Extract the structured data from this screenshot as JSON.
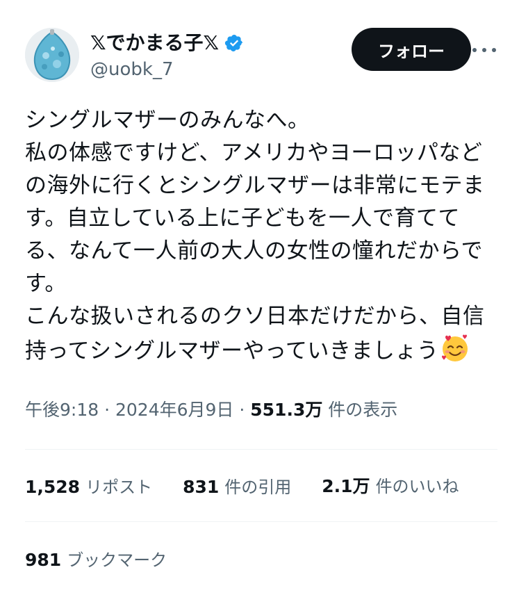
{
  "author": {
    "display_name": "𝕏でかまる子𝕏",
    "handle": "@uobk_7",
    "verified": true
  },
  "follow_button": {
    "label": "フォロー"
  },
  "more_icon": "more-horizontal-icon",
  "tweet": {
    "lines": [
      "シングルマザーのみんなへ。",
      "私の体感ですけど、アメリカやヨーロッパなど",
      "の海外に行くとシングルマザーは非常にモテま",
      "す。自立している上に子どもを一人で育てて",
      "る、なんて一人前の大人の女性の憧れだからで",
      "す。",
      "こんな扱いされるのクソ日本だけだから、自信",
      "持ってシングルマザーやっていきましょう"
    ],
    "emoji": "smiling-face-with-hearts-icon"
  },
  "meta": {
    "time": "午後9:18",
    "separator": " · ",
    "date": "2024年6月9日",
    "views_count": "551.3万",
    "views_label": " 件の表示"
  },
  "stats": {
    "reposts": {
      "count": "1,528",
      "label": "リポスト"
    },
    "quotes": {
      "count": "831",
      "label": "件の引用"
    },
    "likes": {
      "count": "2.1万",
      "label": "件のいいね"
    }
  },
  "bookmarks": {
    "count": "981",
    "label": "ブックマーク"
  },
  "colors": {
    "text_primary": "#0f1419",
    "text_secondary": "#536471",
    "verified_blue": "#1d9bf0",
    "follow_bg": "#0f1419",
    "divider": "#eff3f4"
  }
}
